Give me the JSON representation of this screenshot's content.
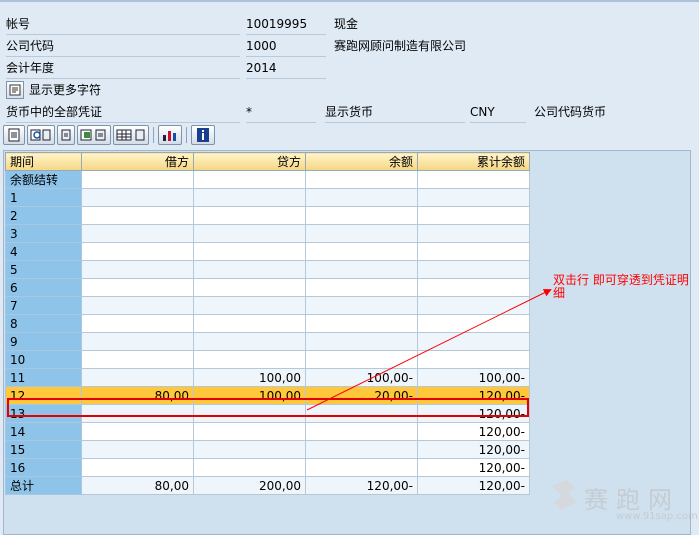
{
  "header": {
    "account_label": "帐号",
    "account_value": "10019995",
    "account_desc": "现金",
    "company_label": "公司代码",
    "company_value": "1000",
    "company_desc": "赛跑网顾问制造有限公司",
    "fiscal_year_label": "会计年度",
    "fiscal_year_value": "2014",
    "more_chars_label": "显示更多字符",
    "currency_docs_label": "货币中的全部凭证",
    "currency_docs_value": "*",
    "display_currency_label": "显示货币",
    "display_currency_value": "CNY",
    "company_currency_label": "公司代码货币"
  },
  "toolbar": {
    "icons": [
      "print-icon",
      "find-icon",
      "find-next-icon",
      "export-icon",
      "layout-icon",
      "chart-icon",
      "info-icon"
    ]
  },
  "table": {
    "columns": [
      "期间",
      "借方",
      "贷方",
      "余额",
      "累计余额"
    ],
    "rows": [
      {
        "period": "余额结转",
        "debit": "",
        "credit": "",
        "balance": "",
        "cumulative": ""
      },
      {
        "period": "1",
        "debit": "",
        "credit": "",
        "balance": "",
        "cumulative": ""
      },
      {
        "period": "2",
        "debit": "",
        "credit": "",
        "balance": "",
        "cumulative": ""
      },
      {
        "period": "3",
        "debit": "",
        "credit": "",
        "balance": "",
        "cumulative": ""
      },
      {
        "period": "4",
        "debit": "",
        "credit": "",
        "balance": "",
        "cumulative": ""
      },
      {
        "period": "5",
        "debit": "",
        "credit": "",
        "balance": "",
        "cumulative": ""
      },
      {
        "period": "6",
        "debit": "",
        "credit": "",
        "balance": "",
        "cumulative": ""
      },
      {
        "period": "7",
        "debit": "",
        "credit": "",
        "balance": "",
        "cumulative": ""
      },
      {
        "period": "8",
        "debit": "",
        "credit": "",
        "balance": "",
        "cumulative": ""
      },
      {
        "period": "9",
        "debit": "",
        "credit": "",
        "balance": "",
        "cumulative": ""
      },
      {
        "period": "10",
        "debit": "",
        "credit": "",
        "balance": "",
        "cumulative": ""
      },
      {
        "period": "11",
        "debit": "",
        "credit": "100,00",
        "balance": "100,00-",
        "cumulative": "100,00-"
      },
      {
        "period": "12",
        "debit": "80,00",
        "credit": "100,00",
        "balance": "20,00-",
        "cumulative": "120,00-"
      },
      {
        "period": "13",
        "debit": "",
        "credit": "",
        "balance": "",
        "cumulative": "120,00-"
      },
      {
        "period": "14",
        "debit": "",
        "credit": "",
        "balance": "",
        "cumulative": "120,00-"
      },
      {
        "period": "15",
        "debit": "",
        "credit": "",
        "balance": "",
        "cumulative": "120,00-"
      },
      {
        "period": "16",
        "debit": "",
        "credit": "",
        "balance": "",
        "cumulative": "120,00-"
      },
      {
        "period": "总计",
        "debit": "80,00",
        "credit": "200,00",
        "balance": "120,00-",
        "cumulative": "120,00-"
      }
    ],
    "selected_period": "12"
  },
  "annotation": {
    "text": "双击行 即可穿透到凭证明细",
    "color": "#ff0000"
  },
  "watermark": {
    "name": "赛跑网",
    "url": "www.91sap.com"
  },
  "colors": {
    "selected_row": "#ffc83a",
    "period_col": "#8fc4ea",
    "header_bg": "#f5d784"
  }
}
